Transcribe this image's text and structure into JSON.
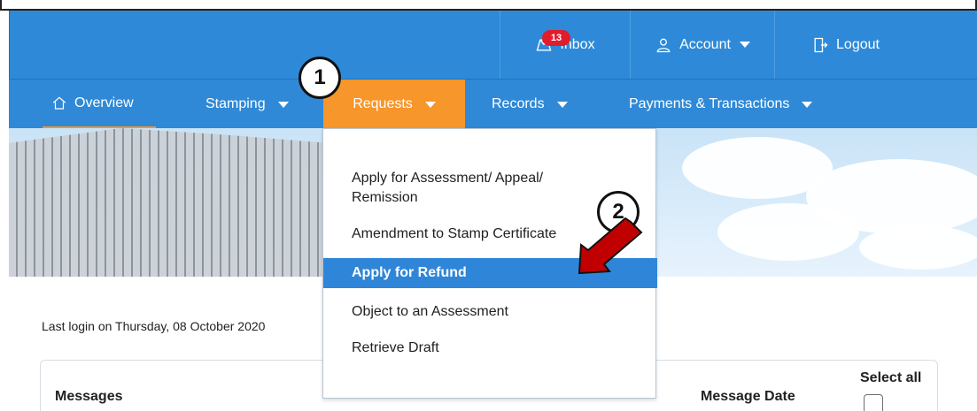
{
  "top": {
    "inbox_label": "Inbox",
    "inbox_badge": "13",
    "account_label": "Account",
    "logout_label": "Logout"
  },
  "nav": {
    "overview": "Overview",
    "stamping": "Stamping",
    "requests": "Requests",
    "records": "Records",
    "payments": "Payments & Transactions"
  },
  "dropdown": {
    "items": [
      "Apply for Assessment/ Appeal/ Remission",
      "Amendment to Stamp Certificate",
      "Apply for Refund",
      "Object to an Assessment",
      "Retrieve Draft"
    ]
  },
  "annotations": {
    "step1": "1",
    "step2": "2"
  },
  "content": {
    "last_login": "Last login on Thursday, 08 October 2020",
    "messages_header": "Messages",
    "message_date_header": "Message Date",
    "select_all_label": "Select all"
  },
  "colors": {
    "topbar": "#2e8ad8",
    "nav": "#2f89d6",
    "accent": "#f7962b",
    "highlight": "#2f86d8",
    "badge": "#e21c2b",
    "annotation_arrow": "#c00000"
  },
  "icons": {
    "inbox": "inbox-icon",
    "account": "account-icon",
    "logout": "logout-icon",
    "overview": "home-icon",
    "caret": "chevron-down-icon"
  }
}
